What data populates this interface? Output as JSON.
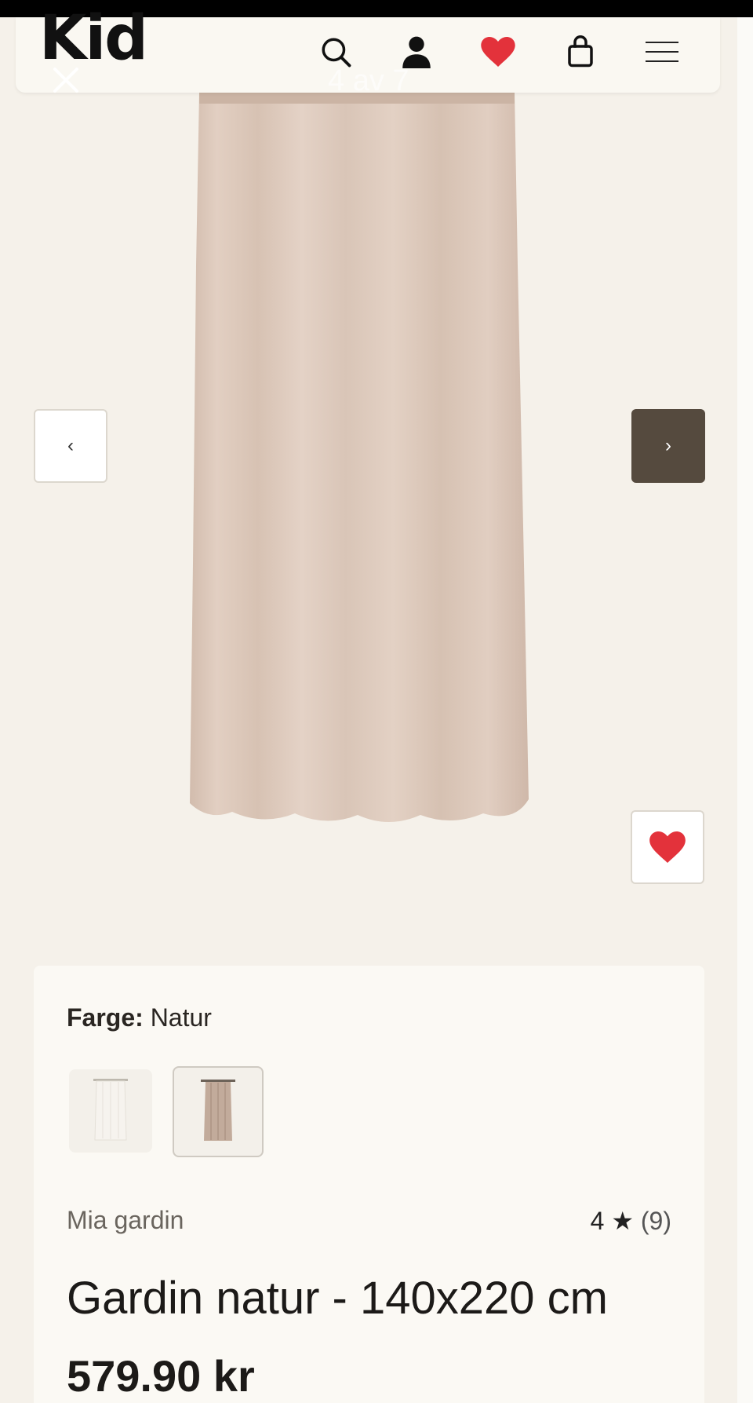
{
  "header": {
    "logo": "Kid",
    "image_counter": "4 av 7",
    "icons": [
      "search-icon",
      "user-icon",
      "heart-icon",
      "bag-icon",
      "menu-icon"
    ]
  },
  "gallery": {
    "prev_icon": "‹",
    "next_icon": "›"
  },
  "product": {
    "color_label": "Farge:",
    "color_value": "Natur",
    "brand": "Mia gardin",
    "rating": "4",
    "rating_star": "★",
    "rating_count": "(9)",
    "name": "Gardin natur - 140x220 cm",
    "price": "579.90 kr"
  },
  "colors": {
    "accent": "#554a3e",
    "heart": "#e3323b",
    "background": "#f5f1ea",
    "curtain": "#ddc8b9"
  }
}
